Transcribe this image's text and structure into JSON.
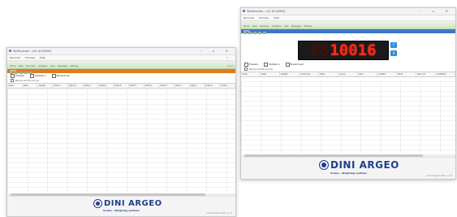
{
  "app": {
    "title": "WeiRecorder - v10.16 (DEMO)",
    "menu": [
      "Recorder",
      "Preview",
      "Help"
    ],
    "help_glyph": "?",
    "toolbar_labels": [
      "Home",
      "Save",
      "Recorder",
      "Configure",
      "Tara",
      "Messages",
      "Settings"
    ],
    "toolbar_version": "10.16",
    "win_controls": "– ▫ ✕"
  },
  "left_window": {
    "status_text": "DEMO",
    "tabs": [
      "Presets",
      "Statistics",
      "Breakdown"
    ],
    "checkbox_label": "Reduce all the records",
    "columns": [
      "Index",
      "Date",
      "Weight",
      "Data A",
      "Data B",
      "Data C",
      "Data D",
      "Data E",
      "Data F",
      "Data G",
      "Data H",
      "Data I",
      "Data J",
      "Data K",
      "Data L"
    ],
    "footer_note": "Load Program 2016 - 3.1.5"
  },
  "right_window": {
    "status_text": "DEMO",
    "display_value": "10016",
    "display_ghost": "88",
    "side_buttons": [
      "T",
      "0"
    ],
    "tabs": [
      "Presets",
      "Statistics",
      "Breakdown"
    ],
    "checkbox_label": "Reduce all the records",
    "columns": [
      "Index",
      "Date",
      "Weight",
      "Customer",
      "Data",
      "Group",
      "Item",
      "Lot/PLU",
      "Mark",
      "Tare Lot",
      "Lot/Batch"
    ],
    "footer_note": "Load Program 2016 - 3.1.5"
  },
  "brand": {
    "name": "DINI ARGEO",
    "tagline": "Scales - Weighing systems"
  },
  "colors": {
    "left_status": "#e07a1f",
    "right_status": "#3c78c8",
    "display_text": "#ff2a1a",
    "brand": "#1f3f8f"
  }
}
